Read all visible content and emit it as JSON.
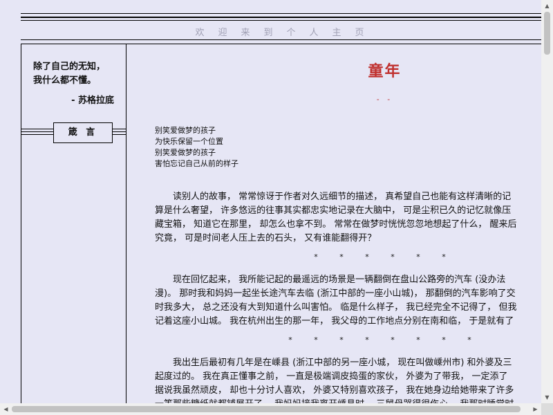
{
  "header": {
    "welcome_chars": [
      "欢",
      "迎",
      "来",
      "到",
      "个",
      "人",
      "主",
      "页"
    ]
  },
  "sidebar": {
    "quote_line1": "除了自己的无知，",
    "quote_line2": "我什么都不懂。",
    "quote_author": "- 苏格拉底",
    "section_label": "箴 言"
  },
  "article": {
    "title": "童年",
    "dash": "- -",
    "poem": [
      "别笑爱做梦的孩子",
      "为快乐保留一个位置",
      "别笑爱做梦的孩子",
      "害怕忘记自己从前的样子"
    ],
    "para1": [
      "　　读别人的故事， 常常惊讶于作者对久远细节的描述， 真希望自己也能有这样清晰的记",
      "算是什么奢望， 许多悠远的往事其实都忠实地记录在大脑中， 可是尘积已久的记忆就像压",
      "藏宝箱， 知道它在那里， 却怎么也拿不到。 常常在做梦时恍恍忽忽地想起了什么， 醒来后",
      "究竟， 可是时间老人压上去的石头， 又有谁能翻得开？"
    ],
    "stars1": "* * * * * *",
    "para2": [
      "　　现在回忆起来， 我所能记起的最遥远的场景是一辆翻倒在盘山公路旁的汽车 (没办法",
      "漫)。 那时我和妈妈一起坐长途汽车去临 (浙江中部的一座小山城)， 那翻倒的汽车影响了交",
      "时我多大， 总之还没有大到知道什么叫害怕。 临是什么样子， 我已经完全不记得了， 但我",
      "记着这座小山城。 我在杭州出生的那一年， 我父母的工作地点分别在南和临， 于是就有了"
    ],
    "stars2": "* * * * * * * *",
    "para3": [
      "　　我出生后最初有几年是在嵊县 (浙江中部的另一座小城， 现在叫做嵊州市) 和外婆及三",
      "起度过的。 我在真正懂事之前， 一直是极端调皮捣蛋的家伙， 外婆为了带我， 一定添了",
      "据说我虽然顽皮， 却也十分讨人喜欢， 外婆又特别喜欢孩子， 我在她身边给她带来了许多",
      "一等那些糖纸就都铺展开了。 我妈妈接我离开嵊县时， 三舅母哭得很伤心。 我那时睡觉时"
    ]
  },
  "scrollbars": {
    "up_arrow": "▲",
    "down_arrow": "▼",
    "left_arrow": "◀",
    "right_arrow": "▶"
  },
  "colors": {
    "background": "#e6e6f5",
    "title": "#c0302e",
    "welcome": "#a0a0b4"
  }
}
